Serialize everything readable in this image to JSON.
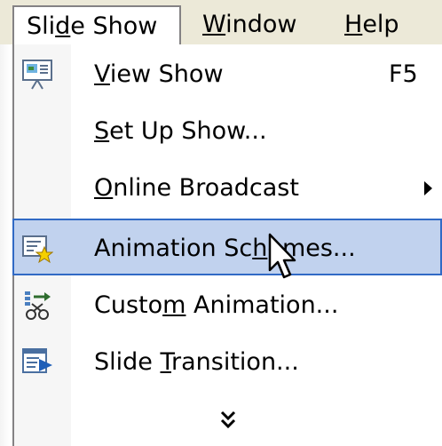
{
  "menubar": {
    "items": [
      {
        "label_pre": "Sli",
        "accel": "d",
        "label_post": "e Show"
      },
      {
        "label_pre": "",
        "accel": "W",
        "label_post": "indow"
      },
      {
        "label_pre": "",
        "accel": "H",
        "label_post": "elp"
      }
    ]
  },
  "menu": {
    "items": [
      {
        "accel": "V",
        "rest": "iew Show",
        "pre": "",
        "shortcut": "F5",
        "icon": "projector-screen-icon"
      },
      {
        "accel": "S",
        "rest": "et Up Show...",
        "pre": "",
        "icon": ""
      },
      {
        "accel": "O",
        "rest": "nline Broadcast",
        "pre": "",
        "icon": "",
        "submenu": true
      },
      {
        "pre": "Animation Sc",
        "accel": "h",
        "rest": "emes...",
        "icon": "animation-schemes-icon",
        "highlighted": true
      },
      {
        "pre": "Custo",
        "accel": "m",
        "rest": " Animation...",
        "icon": "custom-animation-icon"
      },
      {
        "pre": "Slide ",
        "accel": "T",
        "rest": "ransition...",
        "icon": "slide-transition-icon"
      }
    ],
    "expand_icon": "double-chevron-down-icon"
  },
  "colors": {
    "highlight_bg": "#c1d2ee",
    "highlight_border": "#316ac5",
    "menubar_bg": "#ece9d8"
  }
}
